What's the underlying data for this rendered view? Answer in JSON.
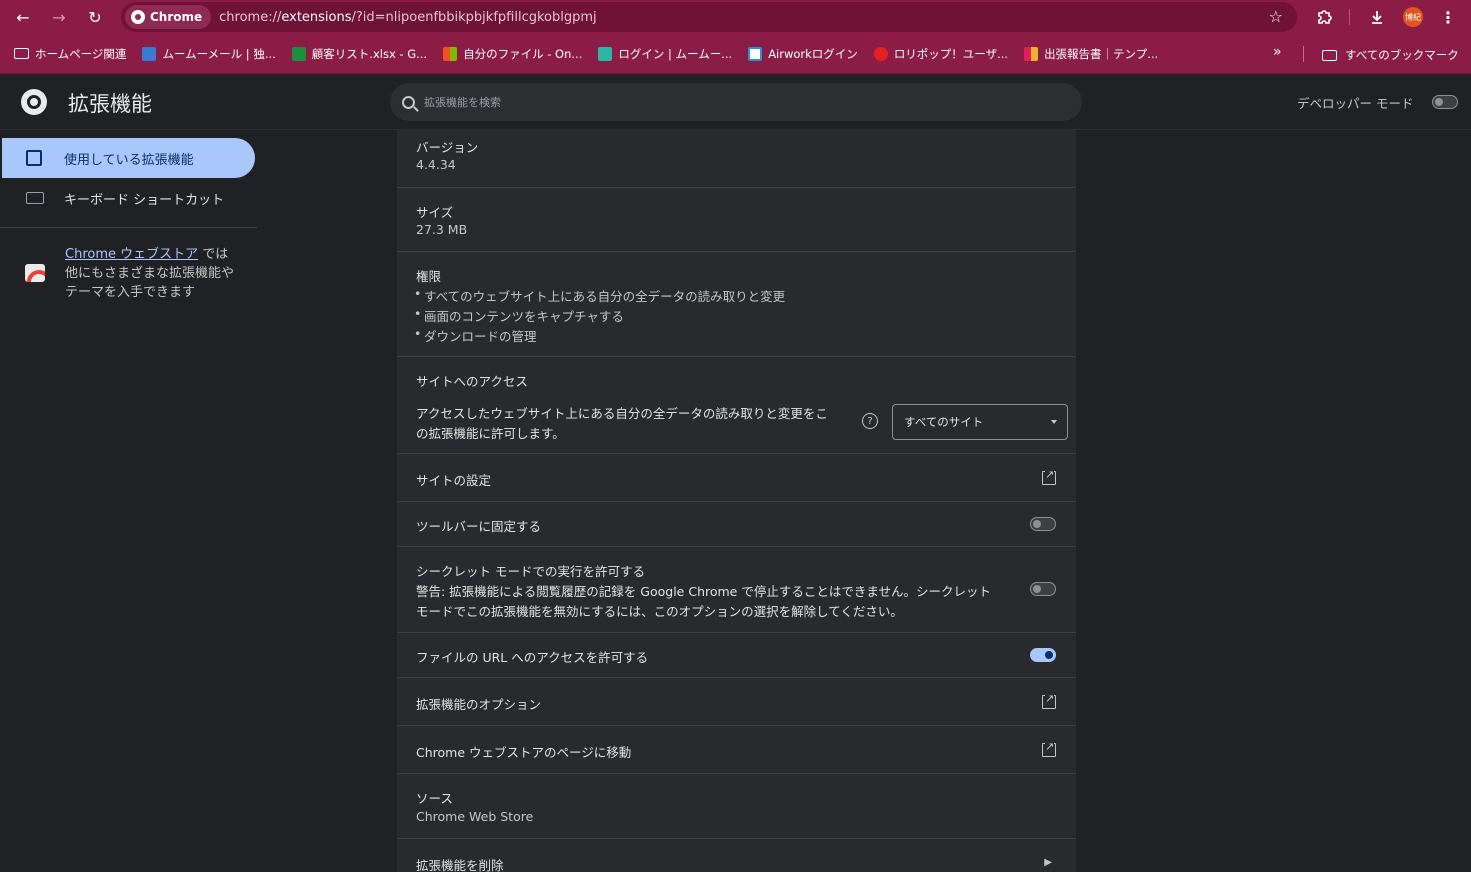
{
  "browser": {
    "url_scheme": "chrome://",
    "url_host": "extensions",
    "url_path": "/?id=nlipoenfbbikpbjkfpfillcgkoblgpmj",
    "chip_label": "Chrome",
    "avatar_text": "博紀"
  },
  "bookmarks": {
    "items": [
      {
        "label": "ホームページ関連",
        "icon": "folder-icon"
      },
      {
        "label": "ムームーメール | 独...",
        "icon": "mail-icon"
      },
      {
        "label": "顧客リスト.xlsx - G...",
        "icon": "sheets-icon"
      },
      {
        "label": "自分のファイル - On...",
        "icon": "microsoft-icon"
      },
      {
        "label": "ログイン | ムームー...",
        "icon": "muumuu-icon"
      },
      {
        "label": "Airworkログイン",
        "icon": "airwork-icon"
      },
      {
        "label": "ロリポップ！ユーザ...",
        "icon": "lolipop-icon"
      },
      {
        "label": "出張報告書｜テンプ...",
        "icon": "slack-icon"
      }
    ],
    "all_bookmarks": "すべてのブックマーク"
  },
  "header": {
    "title": "拡張機能",
    "search_placeholder": "拡張機能を検索",
    "dev_mode_label": "デベロッパー モード"
  },
  "sidebar": {
    "items": [
      {
        "label": "使用している拡張機能"
      },
      {
        "label": "キーボード ショートカット"
      }
    ],
    "store_link": "Chrome ウェブストア",
    "store_text": " では他にもさまざまな拡張機能やテーマを入手できます"
  },
  "details": {
    "version_label": "バージョン",
    "version_value": "4.4.34",
    "size_label": "サイズ",
    "size_value": "27.3 MB",
    "permissions_label": "権限",
    "permissions": [
      "すべてのウェブサイト上にある自分の全データの読み取りと変更",
      "画面のコンテンツをキャプチャする",
      "ダウンロードの管理"
    ],
    "site_access_label": "サイトへのアクセス",
    "site_access_desc_1": "アクセスしたウェブサイト上にある自分の全データの読み取りと変更をこ",
    "site_access_desc_2": "の拡張機能に許可します。",
    "site_access_select": "すべてのサイト",
    "site_settings": "サイトの設定",
    "pin_toolbar": "ツールバーに固定する",
    "incognito_label": "シークレット モードでの実行を許可する",
    "incognito_warning_1": "警告: 拡張機能による閲覧履歴の記録を Google Chrome で停止することはできません。シークレット",
    "incognito_warning_2": "モードでこの拡張機能を無効にするには、このオプションの選択を解除してください。",
    "file_url_label": "ファイルの URL へのアクセスを許可する",
    "options_label": "拡張機能のオプション",
    "store_page_label": "Chrome ウェブストアのページに移動",
    "source_label": "ソース",
    "source_value": "Chrome Web Store",
    "remove_label": "拡張機能を削除"
  },
  "toggles": {
    "developer_mode": false,
    "pin_toolbar": false,
    "incognito": false,
    "file_url": true
  },
  "colors": {
    "toolbar": "#8a1c45",
    "accent": "#a8c7fa",
    "background": "#202124",
    "card": "#292a2d"
  }
}
